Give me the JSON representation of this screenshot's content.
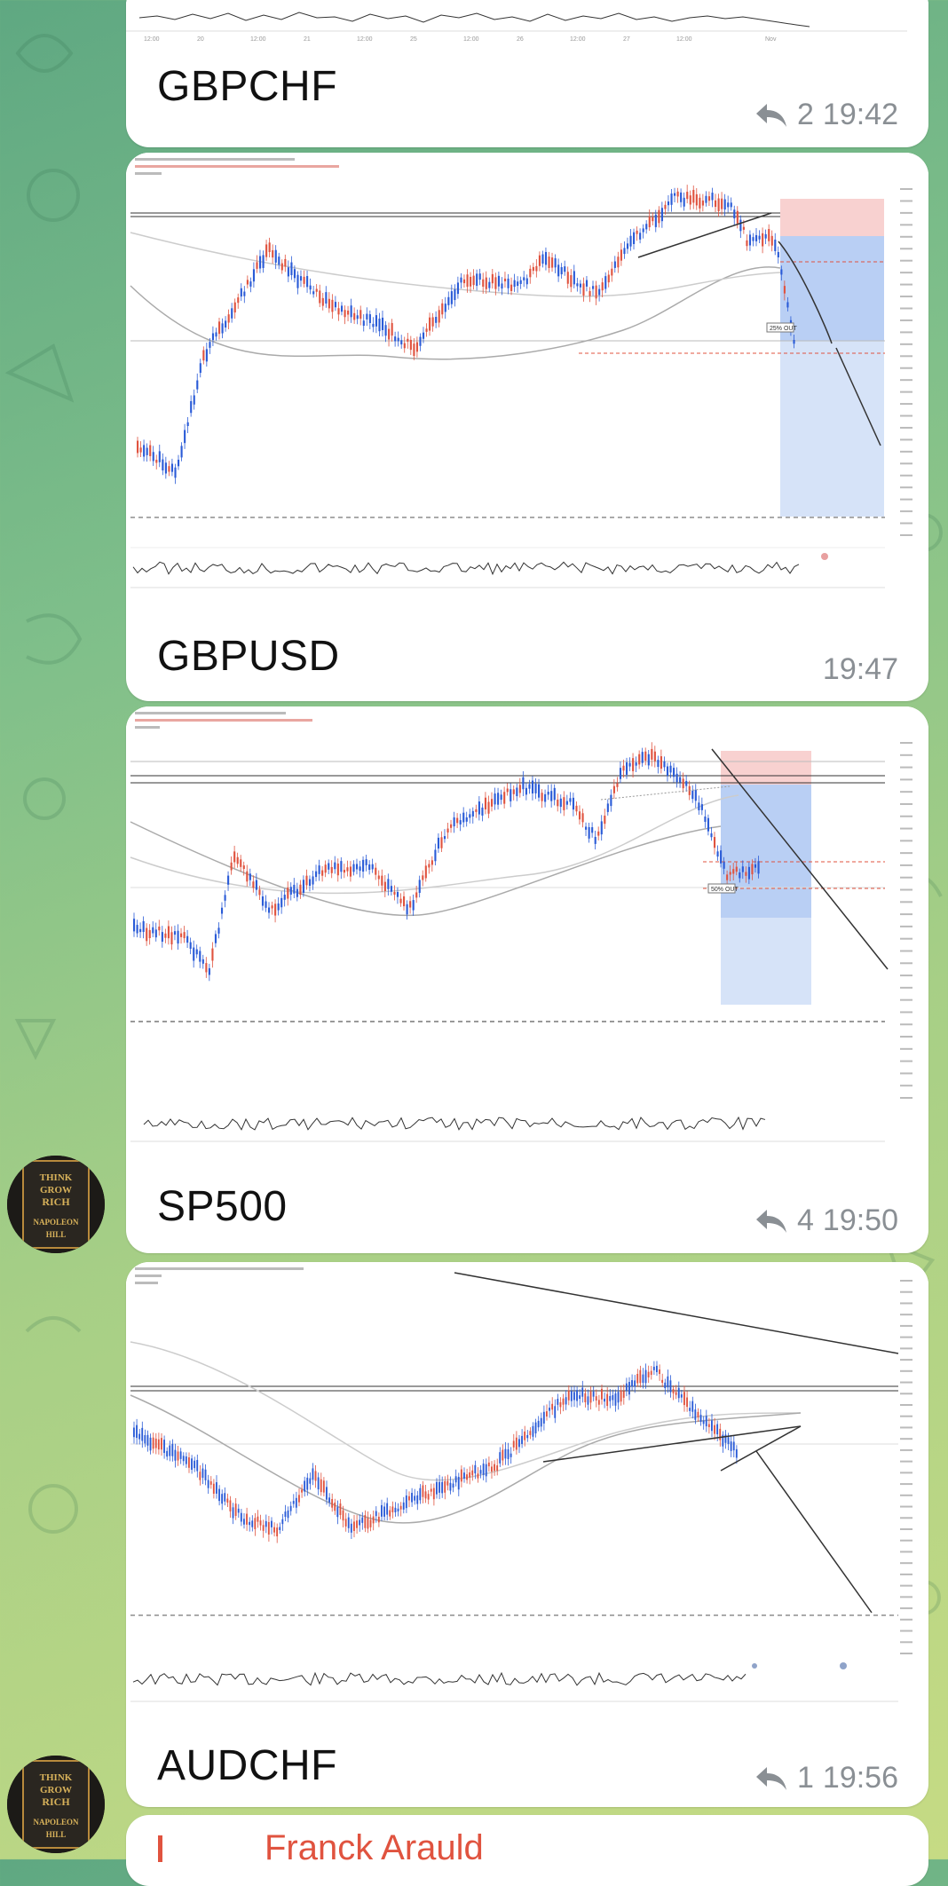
{
  "messages": [
    {
      "caption": "GBPCHF",
      "reply_count": "2",
      "time": "19:42"
    },
    {
      "caption": "GBPUSD",
      "reply_count": "",
      "time": "19:47"
    },
    {
      "caption": "SP500",
      "reply_count": "4",
      "time": "19:50"
    },
    {
      "caption": "AUDCHF",
      "reply_count": "1",
      "time": "19:56"
    }
  ],
  "next_message": {
    "reply_author": "Franck Arauld"
  },
  "avatar": {
    "icon": "book-cover-avatar",
    "title": [
      "THINK",
      "GROW",
      "RICH",
      "NAPOLEON",
      "HILL"
    ]
  },
  "charts": {
    "gbpusd": {
      "labels": {
        "out": "25% OUT"
      }
    },
    "sp500": {
      "labels": {
        "out": "50% OUT"
      }
    }
  },
  "colors": {
    "bubble": "#ffffff",
    "time": "#8a8f94",
    "bull_candle": "#2a5bd7",
    "bear_candle": "#e0533f",
    "stop_zone": "#f8d1d0",
    "target_zone": "#c9dbf7",
    "reply_accent": "#e0533f"
  }
}
